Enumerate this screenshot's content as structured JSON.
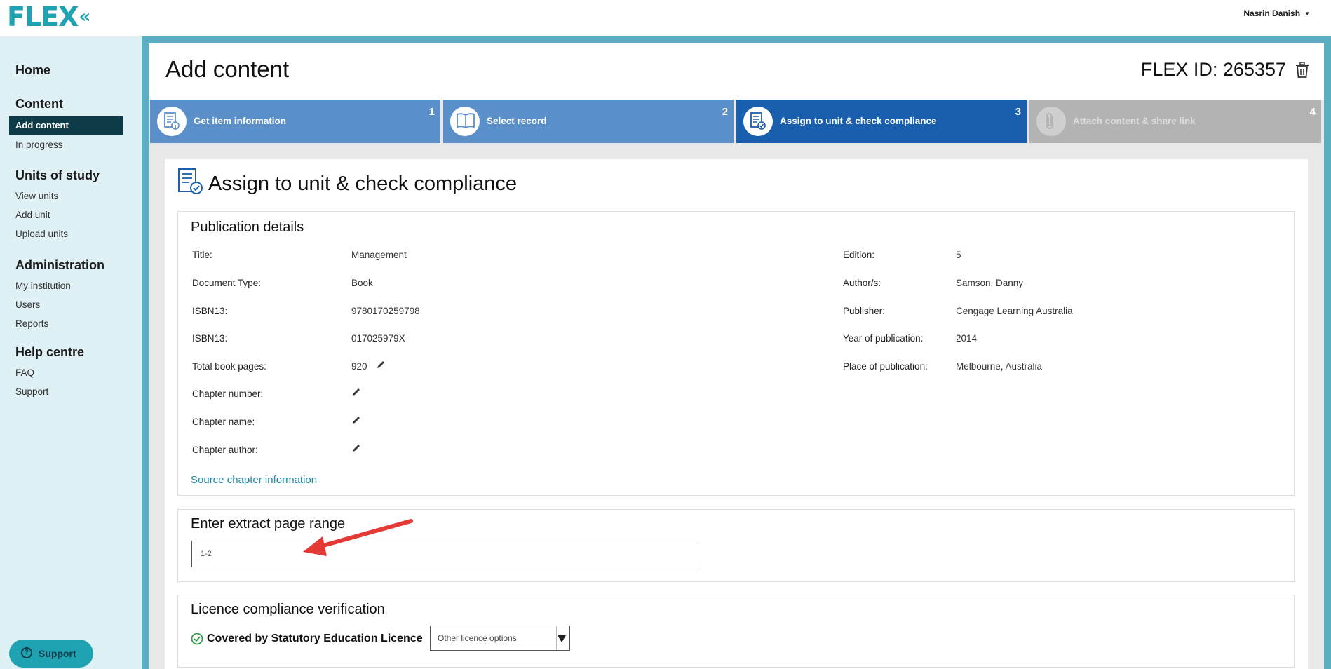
{
  "app": {
    "logo": "FLEX",
    "logo_mark": "«",
    "user": "Nasrin Danish"
  },
  "sidebar": {
    "sections": [
      {
        "heading": "Home",
        "items": []
      },
      {
        "heading": "Content",
        "items": [
          "Add content",
          "In progress"
        ]
      },
      {
        "heading": "Units of study",
        "items": [
          "View units",
          "Add unit",
          "Upload units"
        ]
      },
      {
        "heading": "Administration",
        "items": [
          "My institution",
          "Users",
          "Reports"
        ]
      },
      {
        "heading": "Help centre",
        "items": [
          "FAQ",
          "Support"
        ]
      }
    ],
    "active_item": "Add content",
    "support_button": "Support"
  },
  "header": {
    "title": "Add content",
    "flex_id": "FLEX ID: 265357"
  },
  "steps": [
    {
      "number": "1",
      "label": "Get item information",
      "state": "complete"
    },
    {
      "number": "2",
      "label": "Select record",
      "state": "complete"
    },
    {
      "number": "3",
      "label": "Assign to unit & check compliance",
      "state": "active"
    },
    {
      "number": "4",
      "label": "Attach content & share link",
      "state": "disabled"
    }
  ],
  "section": {
    "title": "Assign to unit & check compliance"
  },
  "publication": {
    "heading": "Publication details",
    "left": [
      {
        "label": "Title:",
        "value": "Management"
      },
      {
        "label": "Document Type:",
        "value": "Book"
      },
      {
        "label": "ISBN13:",
        "value": "9780170259798"
      },
      {
        "label": "ISBN13:",
        "value": "017025979X"
      },
      {
        "label": "Total book pages:",
        "value": "920"
      },
      {
        "label": "Chapter number:",
        "value": ""
      },
      {
        "label": "Chapter name:",
        "value": ""
      },
      {
        "label": "Chapter author:",
        "value": ""
      }
    ],
    "right": [
      {
        "label": "Edition:",
        "value": "5"
      },
      {
        "label": "Author/s:",
        "value": "Samson, Danny"
      },
      {
        "label": "Publisher:",
        "value": "Cengage Learning Australia"
      },
      {
        "label": "Year of publication:",
        "value": "2014"
      },
      {
        "label": "Place of publication:",
        "value": "Melbourne, Australia"
      }
    ],
    "source_link": "Source chapter information"
  },
  "extract": {
    "heading": "Enter extract page range",
    "value": "1-2"
  },
  "licence": {
    "heading": "Licence compliance verification",
    "status": "Covered by Statutory Education Licence",
    "select_value": "Other licence options"
  },
  "colors": {
    "brand": "#1fa3b3",
    "step_complete": "#5b8fc9",
    "step_active": "#1a5fae",
    "step_disabled": "#b3b3b3",
    "annotation": "#e53935"
  }
}
